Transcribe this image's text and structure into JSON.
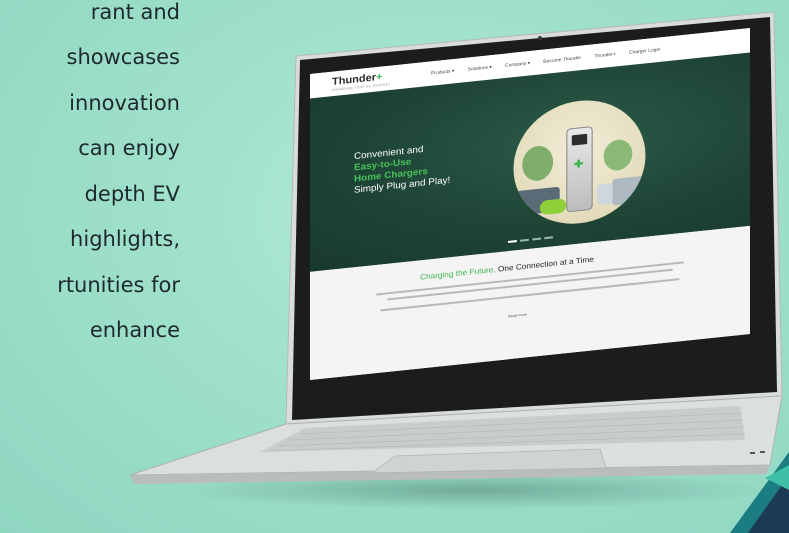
{
  "left_text": {
    "lines": [
      "rant    and",
      "showcases",
      "innovation",
      "can  enjoy",
      "depth   EV",
      "highlights,",
      "rtunities for",
      "enhance"
    ]
  },
  "website": {
    "logo": "Thunder",
    "logo_plus": "+",
    "logo_tagline": "POWERING YOUR EV JOURNEY",
    "nav_items": [
      "Products ▾",
      "Solutions ▾",
      "Company ▾",
      "Become Thunder",
      "Thunder+",
      "Charger Login"
    ],
    "hero": {
      "line1": "Convenient and",
      "line2": "Easy-to-Use",
      "line3": "Home Chargers",
      "line4": "Simply Plug and Play!"
    },
    "section": {
      "title_green": "Charging the Future,",
      "title_rest": " One Connection at a Time",
      "read_more": "Read more"
    }
  },
  "colors": {
    "background": "#9fe0cc",
    "hero": "#1f4536",
    "accent_green": "#3fb550",
    "corner_teal": "#1b7d82",
    "corner_navy": "#1d3a55"
  }
}
